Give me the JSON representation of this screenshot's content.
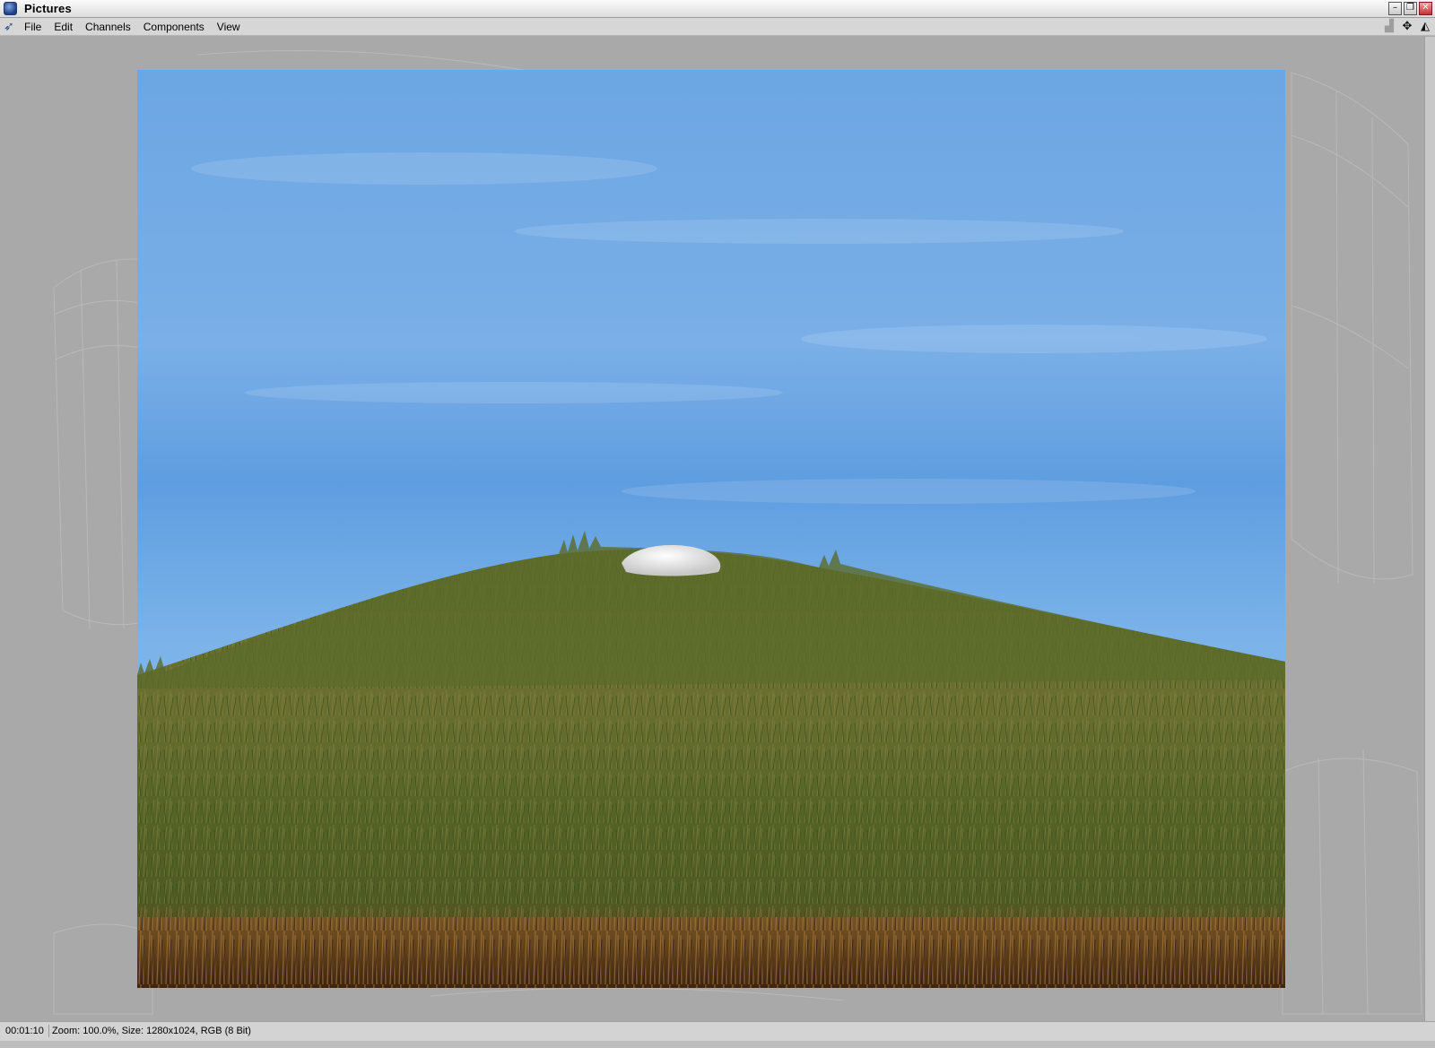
{
  "window": {
    "title": "Pictures",
    "icon": "cinema4d-app-icon",
    "controls": {
      "minimize": "–",
      "restore": "❐",
      "close": "✕"
    }
  },
  "menu": {
    "items": [
      "File",
      "Edit",
      "Channels",
      "Components",
      "View"
    ],
    "tools": [
      "histogram-icon",
      "move-icon",
      "zoom-icon"
    ]
  },
  "status": {
    "time": "00:01:10",
    "info": "Zoom: 100.0%, Size: 1280x1024, RGB (8 Bit)"
  },
  "colors": {
    "sky": "#6ca6e3",
    "grass_dark": "#4f5f22",
    "grass_light": "#8a8a3a",
    "soil": "#6b4420",
    "rock": "#e6e6e6",
    "workspace": "#a9a9a9"
  }
}
